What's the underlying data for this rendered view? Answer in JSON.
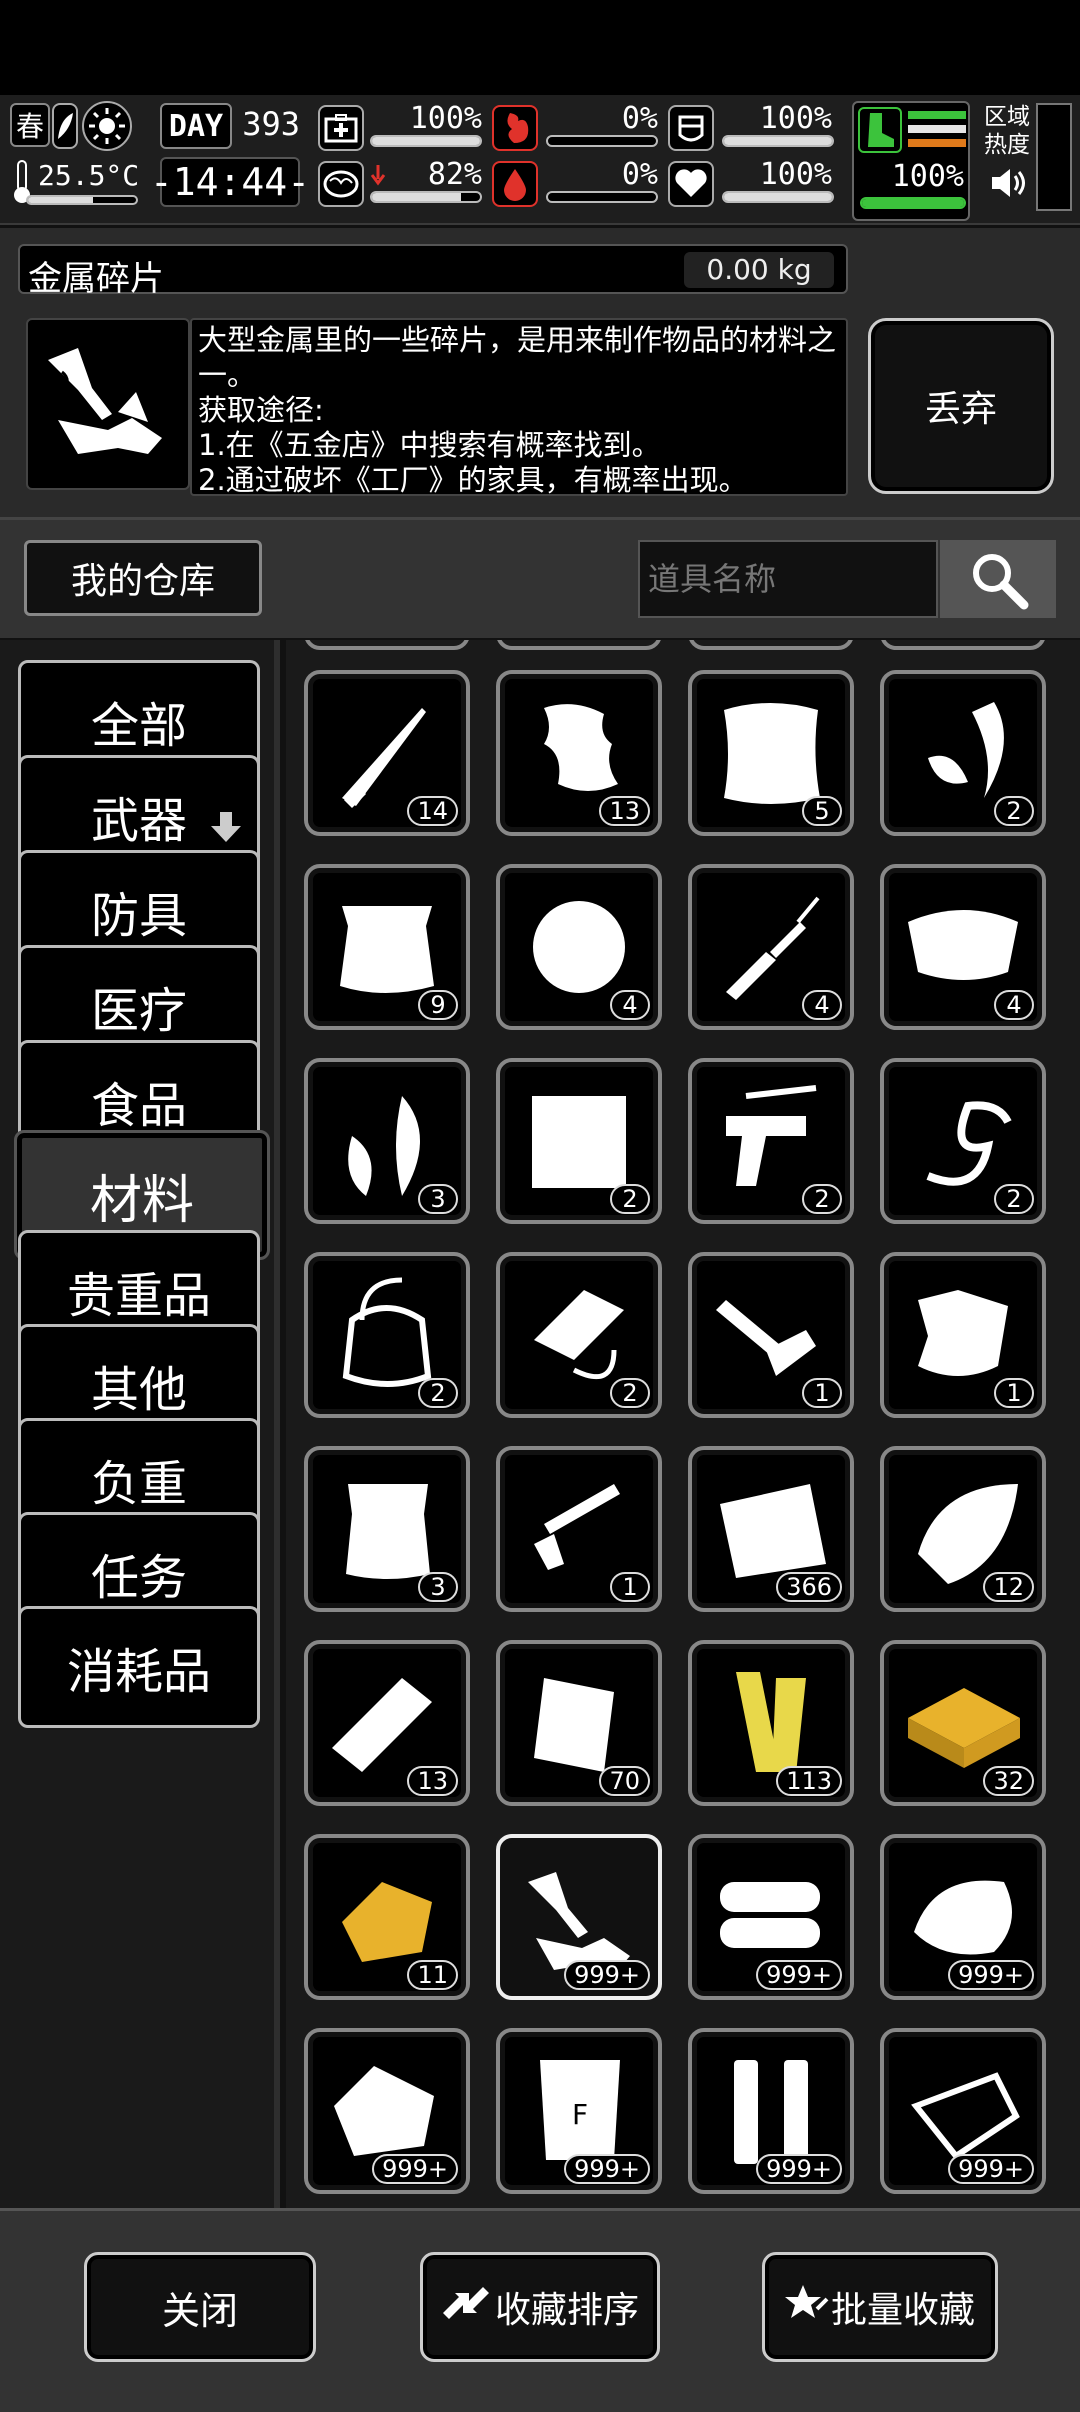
{
  "hud": {
    "season": "春",
    "temperature": "25.5°C",
    "day_label": "DAY",
    "day_value": "393",
    "time": "-14:44-",
    "stats": [
      {
        "name": "health",
        "value": "100%",
        "fill": 1.0
      },
      {
        "name": "hunger",
        "value": "0%",
        "fill": 0.0
      },
      {
        "name": "armor",
        "value": "100%",
        "fill": 1.0
      },
      {
        "name": "brain",
        "value": "82%",
        "fill": 0.82
      },
      {
        "name": "thirst",
        "value": "0%",
        "fill": 0.0
      },
      {
        "name": "heart",
        "value": "100%",
        "fill": 1.0
      }
    ],
    "stamina_value": "100%",
    "region_heat_label": "区域热度"
  },
  "item": {
    "name": "金属碎片",
    "weight": "0.00 kg",
    "description": "大型金属里的一些碎片，是用来制作物品的材料之一。\n获取途径:\n1.在《五金店》中搜索有概率找到。\n2.通过破坏《工厂》的家具，有概率出现。",
    "discard_label": "丢弃"
  },
  "toolbar": {
    "warehouse_label": "我的仓库",
    "search_placeholder": "道具名称"
  },
  "categories": [
    {
      "label": "全部",
      "active": false
    },
    {
      "label": "武器",
      "active": false,
      "has_arrow": true
    },
    {
      "label": "防具",
      "active": false
    },
    {
      "label": "医疗",
      "active": false
    },
    {
      "label": "食品",
      "active": false
    },
    {
      "label": "材料",
      "active": true
    },
    {
      "label": "贵重品",
      "active": false
    },
    {
      "label": "其他",
      "active": false
    },
    {
      "label": "负重",
      "active": false
    },
    {
      "label": "任务",
      "active": false
    },
    {
      "label": "消耗品",
      "active": false
    }
  ],
  "items": [
    {
      "icon": "knife-blade-icon",
      "count": "14"
    },
    {
      "icon": "fur-scrap-icon",
      "count": "13"
    },
    {
      "icon": "cloth-sack-icon",
      "count": "5"
    },
    {
      "icon": "claw-icon",
      "count": "2"
    },
    {
      "icon": "animal-pelt-icon",
      "count": "9"
    },
    {
      "icon": "cotton-ball-icon",
      "count": "4"
    },
    {
      "icon": "broken-rifle-icon",
      "count": "4"
    },
    {
      "icon": "fur-rug-icon",
      "count": "4"
    },
    {
      "icon": "feathers-icon",
      "count": "3"
    },
    {
      "icon": "hay-bale-icon",
      "count": "2"
    },
    {
      "icon": "pistol-parts-icon",
      "count": "2"
    },
    {
      "icon": "vine-icon",
      "count": "2"
    },
    {
      "icon": "bag-strap-icon",
      "count": "2"
    },
    {
      "icon": "wire-block-icon",
      "count": "2"
    },
    {
      "icon": "folding-knife-icon",
      "count": "1"
    },
    {
      "icon": "leather-scrap-icon",
      "count": "1"
    },
    {
      "icon": "small-pelt-icon",
      "count": "3"
    },
    {
      "icon": "gun-parts-icon",
      "count": "1"
    },
    {
      "icon": "glass-shard-icon",
      "count": "366"
    },
    {
      "icon": "wood-planks-icon",
      "count": "12"
    },
    {
      "icon": "log-icon",
      "count": "13"
    },
    {
      "icon": "metal-plate-icon",
      "count": "70"
    },
    {
      "icon": "wood-boards-icon",
      "count": "113"
    },
    {
      "icon": "gold-bar-icon",
      "count": "32"
    },
    {
      "icon": "gold-nugget-icon",
      "count": "11"
    },
    {
      "icon": "metal-fragment-icon",
      "count": "999+",
      "selected": true
    },
    {
      "icon": "log-pile-icon",
      "count": "999+"
    },
    {
      "icon": "fiber-tuft-icon",
      "count": "999+"
    },
    {
      "icon": "rock-icon",
      "count": "999+"
    },
    {
      "icon": "fertilizer-bag-icon",
      "count": "999+"
    },
    {
      "icon": "metal-pipes-icon",
      "count": "999+"
    },
    {
      "icon": "scrap-sheets-icon",
      "count": "999+"
    }
  ],
  "bottom": {
    "close_label": "关闭",
    "sort_label": "收藏排序",
    "batch_label": "批量收藏"
  },
  "colors": {
    "gold": "#e8b22c",
    "wood_yellow": "#e8d84a",
    "stamina_green": "#3cc33c",
    "danger_red": "#e0322b"
  }
}
